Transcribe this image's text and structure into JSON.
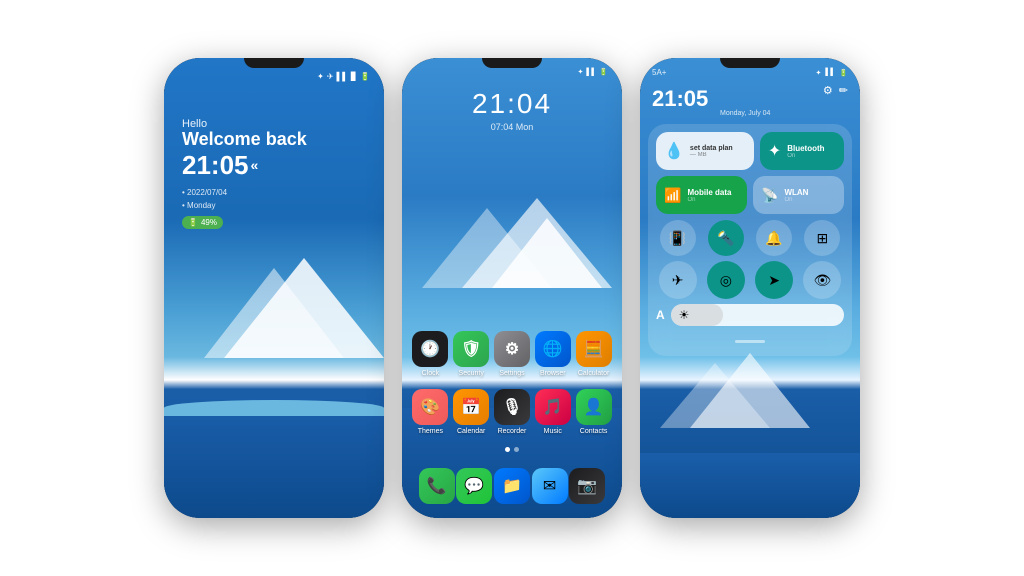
{
  "phone1": {
    "greeting": "Hello",
    "welcome": "Welcome back",
    "time": "21:05",
    "arrows": "«",
    "date": "• 2022/07/04",
    "day": "• Monday",
    "battery": "49%",
    "status_icons": "⊕ ✈ ▌▌ 📶"
  },
  "phone2": {
    "clock": "21:04",
    "date_line": "07:04  Mon",
    "apps_row1": [
      {
        "label": "Clock",
        "emoji": "🕐"
      },
      {
        "label": "Security",
        "emoji": "🛡"
      },
      {
        "label": "Settings",
        "emoji": "⚙"
      },
      {
        "label": "Browser",
        "emoji": "🌐"
      },
      {
        "label": "Calculator",
        "emoji": "🧮"
      }
    ],
    "apps_row2": [
      {
        "label": "Themes",
        "emoji": "🎨"
      },
      {
        "label": "Calendar",
        "emoji": "📅"
      },
      {
        "label": "Recorder",
        "emoji": "🎙"
      },
      {
        "label": "Music",
        "emoji": "🎵"
      },
      {
        "label": "Contacts",
        "emoji": "👤"
      }
    ],
    "dock": [
      {
        "label": "Phone",
        "emoji": "📞"
      },
      {
        "label": "Messages",
        "emoji": "💬"
      },
      {
        "label": "Files",
        "emoji": "📁"
      },
      {
        "label": "Email",
        "emoji": "✉"
      },
      {
        "label": "Camera",
        "emoji": "📷"
      }
    ]
  },
  "phone3": {
    "signal_label": "5A+",
    "time": "21:05",
    "date_info": "Monday, July 04",
    "tiles": {
      "data_plan": "set data plan",
      "data_sub": "— MB",
      "bluetooth": "Bluetooth",
      "bluetooth_sub": "On",
      "mobile_data": "Mobile data",
      "mobile_sub": "On",
      "wlan": "WLAN",
      "wlan_sub": "On"
    },
    "brightness": "A"
  }
}
